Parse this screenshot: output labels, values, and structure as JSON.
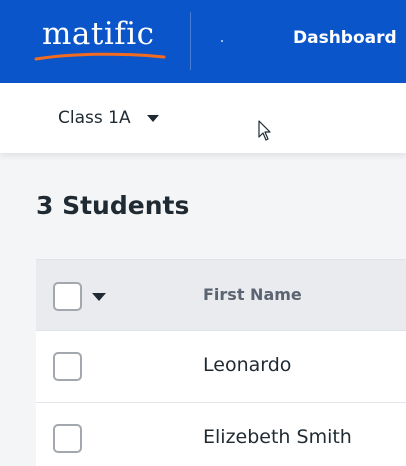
{
  "header": {
    "logo_text": "matific",
    "nav_dashboard": "Dashboard",
    "brand_color": "#0a55c9",
    "accent_color": "#f26b21"
  },
  "class_selector": {
    "selected": "Class 1A",
    "icon": "chevron-down-icon"
  },
  "students": {
    "count_label": "3 Students",
    "table": {
      "columns": [
        "First Name"
      ],
      "rows": [
        {
          "first_name": "Leonardo"
        },
        {
          "first_name": "Elizebeth Smith"
        }
      ]
    }
  }
}
